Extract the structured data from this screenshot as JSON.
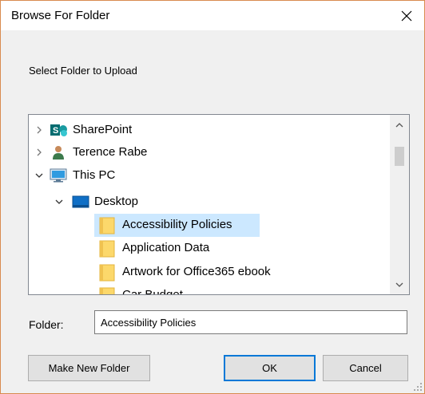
{
  "window": {
    "title": "Browse For Folder"
  },
  "prompt": "Select Folder to Upload",
  "tree": {
    "items": [
      {
        "label": "SharePoint",
        "icon": "sharepoint-icon",
        "expander": "collapsed"
      },
      {
        "label": "Terence Rabe",
        "icon": "user-icon",
        "expander": "collapsed"
      },
      {
        "label": "This PC",
        "icon": "computer-icon",
        "expander": "expanded"
      },
      {
        "label": "Desktop",
        "icon": "desktop-folder-icon",
        "expander": "expanded"
      },
      {
        "label": "Accessibility Policies",
        "icon": "folder-icon",
        "selected": true
      },
      {
        "label": "Application Data",
        "icon": "folder-icon"
      },
      {
        "label": "Artwork for Office365 ebook",
        "icon": "folder-icon"
      },
      {
        "label": "Car Budget",
        "icon": "folder-icon"
      }
    ]
  },
  "folder": {
    "label": "Folder:",
    "value": "Accessibility Policies"
  },
  "buttons": {
    "new_folder": "Make New Folder",
    "ok": "OK",
    "cancel": "Cancel"
  },
  "colors": {
    "selection": "#cce8ff",
    "accent": "#0078d7",
    "folder": "#fcd86b",
    "border": "#d98b4f"
  }
}
